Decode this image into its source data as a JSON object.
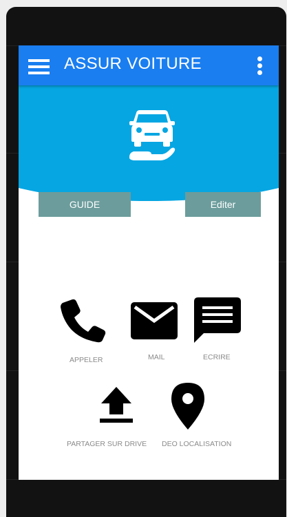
{
  "app_bar": {
    "title": "ASSUR VOITURE",
    "background_color": "#1a7ef0",
    "menu_icon": "hamburger-menu-icon",
    "overflow_icon": "more-vert-icon"
  },
  "hero": {
    "background_color": "#06a6e2",
    "icon": "car-in-hand-icon"
  },
  "buttons": {
    "guide_label": "GUIDE",
    "editer_label": "Editer",
    "color": "#6c9c9c"
  },
  "actions": [
    {
      "label": "APPELER",
      "icon": "phone-icon"
    },
    {
      "label": "MAIL",
      "icon": "mail-icon"
    },
    {
      "label": "ECRIRE",
      "icon": "message-icon"
    },
    {
      "label": "PARTAGER SUR DRIVE",
      "icon": "upload-icon"
    },
    {
      "label": "DEO LOCALISATION",
      "icon": "location-pin-icon"
    }
  ]
}
